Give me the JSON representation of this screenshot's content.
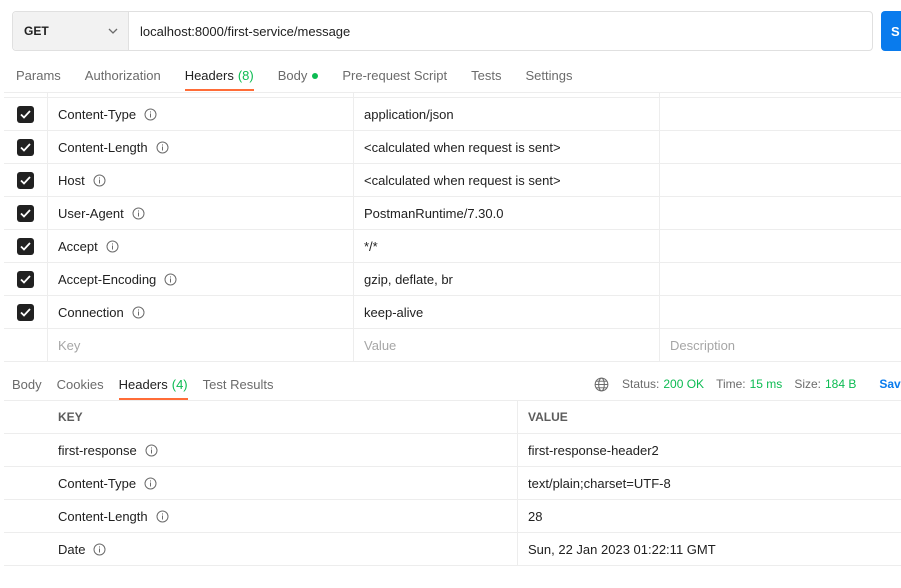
{
  "request": {
    "method": "GET",
    "url": "localhost:8000/first-service/message",
    "send_label": "S"
  },
  "request_tabs": [
    {
      "label": "Params"
    },
    {
      "label": "Authorization"
    },
    {
      "label": "Headers",
      "count": "(8)"
    },
    {
      "label": "Body"
    },
    {
      "label": "Pre-request Script"
    },
    {
      "label": "Tests"
    },
    {
      "label": "Settings"
    }
  ],
  "request_headers": {
    "rows": [
      {
        "key": "Content-Type",
        "value": "application/json"
      },
      {
        "key": "Content-Length",
        "value": "<calculated when request is sent>"
      },
      {
        "key": "Host",
        "value": "<calculated when request is sent>"
      },
      {
        "key": "User-Agent",
        "value": "PostmanRuntime/7.30.0"
      },
      {
        "key": "Accept",
        "value": "*/*"
      },
      {
        "key": "Accept-Encoding",
        "value": "gzip, deflate, br"
      },
      {
        "key": "Connection",
        "value": "keep-alive"
      }
    ],
    "placeholder": {
      "key": "Key",
      "value": "Value",
      "description": "Description"
    }
  },
  "response_tabs": [
    {
      "label": "Body"
    },
    {
      "label": "Cookies"
    },
    {
      "label": "Headers",
      "count": "(4)"
    },
    {
      "label": "Test Results"
    }
  ],
  "response_status": {
    "status_label": "Status:",
    "status_value": "200 OK",
    "time_label": "Time:",
    "time_value": "15 ms",
    "size_label": "Size:",
    "size_value": "184 B",
    "save_label": "Save"
  },
  "response_headers": {
    "columns": {
      "key": "KEY",
      "value": "VALUE"
    },
    "rows": [
      {
        "key": "first-response",
        "value": "first-response-header2"
      },
      {
        "key": "Content-Type",
        "value": "text/plain;charset=UTF-8"
      },
      {
        "key": "Content-Length",
        "value": "28"
      },
      {
        "key": "Date",
        "value": "Sun, 22 Jan 2023 01:22:11 GMT"
      }
    ]
  },
  "colors": {
    "accent_orange": "#ff6c37",
    "status_green": "#0cbb52",
    "send_blue": "#097bed"
  },
  "icons": {
    "checkbox": "check-icon",
    "info": "info-icon",
    "globe": "globe-icon",
    "dropdown": "chevron-down-icon"
  }
}
